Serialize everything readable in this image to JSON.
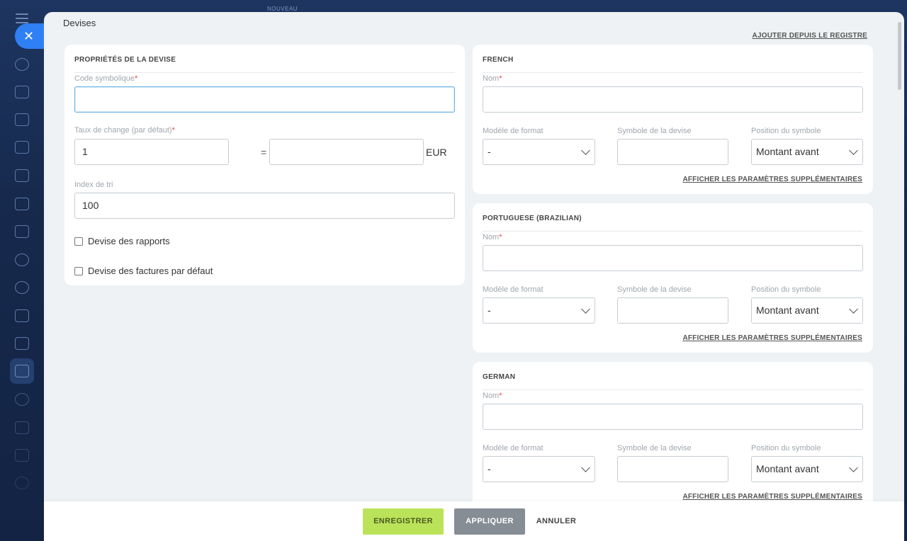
{
  "top_badge": "NOUVEAU",
  "sidebar": {
    "icons": [
      "sync-icon",
      "chat-icon",
      "tasks-icon",
      "calendar-icon",
      "document-icon",
      "drive-icon",
      "mail-icon",
      "contacts-icon",
      "crm-icon",
      "sites-icon",
      "checklist-icon",
      "filter-icon",
      "package-icon",
      "cart-icon",
      "card-icon",
      "user-icon"
    ]
  },
  "slider": {
    "title": "Devises",
    "register_link": "AJOUTER DEPUIS LE REGISTRE"
  },
  "properties": {
    "title": "PROPRIÉTÉS DE LA DEVISE",
    "code_label": "Code symbolique",
    "code_value": "",
    "rate_label": "Taux de change (par défaut)",
    "rate_value": "1",
    "equals": "=",
    "rate_base_value": "",
    "base_currency": "EUR",
    "sort_label": "Index de tri",
    "sort_value": "100",
    "report_currency_label": "Devise des rapports",
    "invoice_currency_label": "Devise des factures par défaut"
  },
  "languages": [
    {
      "title": "FRENCH",
      "name_label": "Nom",
      "format_label": "Modèle de format",
      "format_value": "-",
      "symbol_label": "Symbole de la devise",
      "position_label": "Position du symbole",
      "position_value": "Montant avant",
      "more_link": "AFFICHER LES PARAMÈTRES SUPPLÉMENTAIRES"
    },
    {
      "title": "PORTUGUESE (BRAZILIAN)",
      "name_label": "Nom",
      "format_label": "Modèle de format",
      "format_value": "-",
      "symbol_label": "Symbole de la devise",
      "position_label": "Position du symbole",
      "position_value": "Montant avant",
      "more_link": "AFFICHER LES PARAMÈTRES SUPPLÉMENTAIRES"
    },
    {
      "title": "GERMAN",
      "name_label": "Nom",
      "format_label": "Modèle de format",
      "format_value": "-",
      "symbol_label": "Symbole de la devise",
      "position_label": "Position du symbole",
      "position_value": "Montant avant",
      "more_link": "AFFICHER LES PARAMÈTRES SUPPLÉMENTAIRES"
    }
  ],
  "footer": {
    "save": "ENREGISTRER",
    "apply": "APPLIQUER",
    "cancel": "ANNULER"
  },
  "colors": {
    "accent": "#2f7ff5",
    "save_button": "#bbe35a",
    "apply_button": "#878d94",
    "required": "#e04848"
  }
}
